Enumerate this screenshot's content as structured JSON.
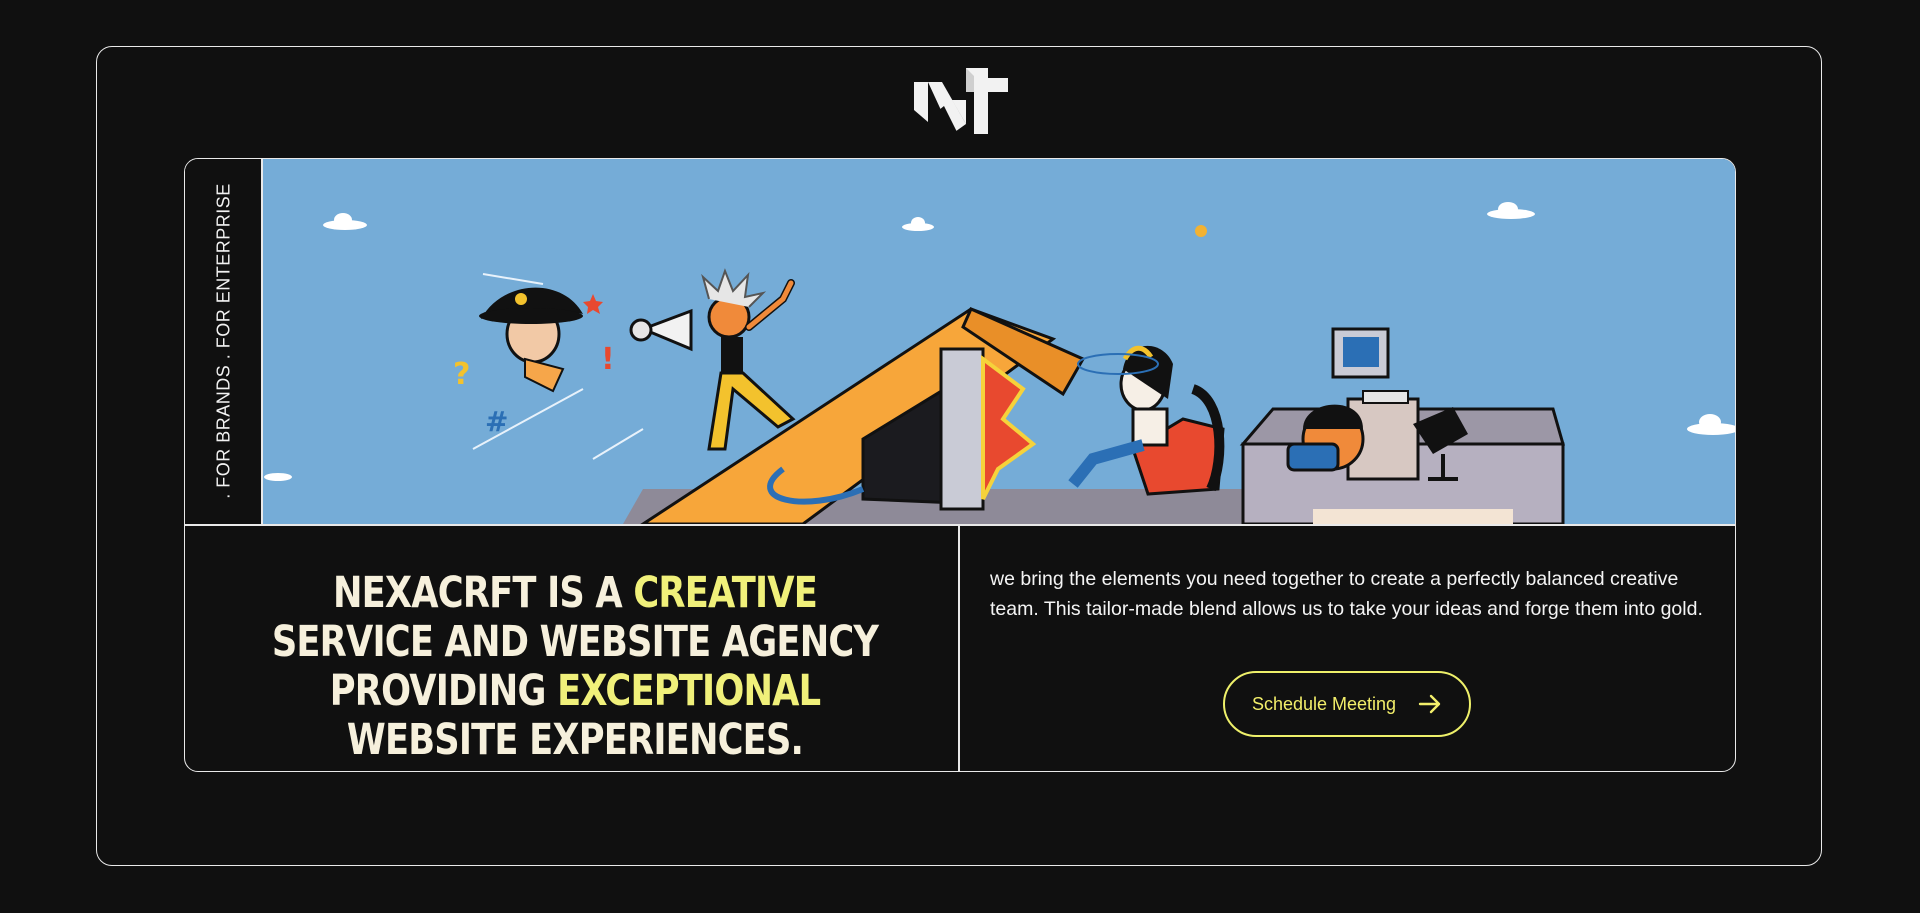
{
  "brand": {
    "logo_icon": "nt-monogram-logo"
  },
  "side_rail": {
    "text": ". FOR BRANDS . FOR ENTERPRISE"
  },
  "hero": {
    "illustration": "cartoon-rooftop-scene"
  },
  "headline": {
    "part1": "NEXACRFT IS A ",
    "highlight1": "CREATIVE",
    "part2": " SERVICE AND WEBSITE AGENCY PROVIDING ",
    "highlight2": "EXCEPTIONAL",
    "part3": " WEBSITE EXPERIENCES."
  },
  "description": "we bring the elements you need together to create a perfectly balanced creative team. This tailor-made blend allows us to take your ideas and forge them into gold.",
  "cta": {
    "label": "Schedule Meeting",
    "icon": "arrow-right-icon"
  },
  "colors": {
    "background": "#101010",
    "accent": "#f0f07a",
    "sky": "#75acd7",
    "text": "#f6f0dc"
  }
}
